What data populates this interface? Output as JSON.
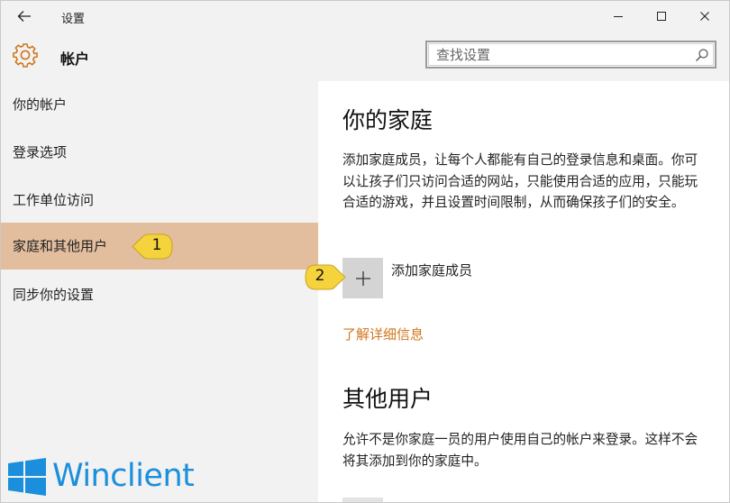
{
  "window": {
    "title": "设置"
  },
  "header": {
    "title": "帐户",
    "search_placeholder": "查找设置"
  },
  "sidebar": {
    "items": [
      {
        "label": "你的帐户"
      },
      {
        "label": "登录选项"
      },
      {
        "label": "工作单位访问"
      },
      {
        "label": "家庭和其他用户",
        "selected": true
      },
      {
        "label": "同步你的设置"
      }
    ]
  },
  "family": {
    "heading": "你的家庭",
    "description": "添加家庭成员，让每个人都能有自己的登录信息和桌面。你可以让孩子们只访问合适的网站，只能使用合适的应用，只能玩合适的游戏，并且设置时间限制，从而确保孩子们的安全。",
    "add_label": "添加家庭成员",
    "learn_more": "了解详细信息"
  },
  "others": {
    "heading": "其他用户",
    "description": "允许不是你家庭一员的用户使用自己的帐户来登录。这样不会将其添加到你的家庭中。"
  },
  "callouts": [
    "1",
    "2"
  ],
  "watermark": {
    "text": "Winclient"
  },
  "colors": {
    "accent": "#d0761e",
    "selected_bg": "#e2bd9e",
    "callout": "#f5d33c",
    "logo_blue": "#1b8fdb"
  },
  "icons": [
    "back-arrow-icon",
    "minimize-icon",
    "maximize-icon",
    "close-icon",
    "gear-icon",
    "search-icon",
    "plus-icon",
    "windows-logo-icon"
  ]
}
